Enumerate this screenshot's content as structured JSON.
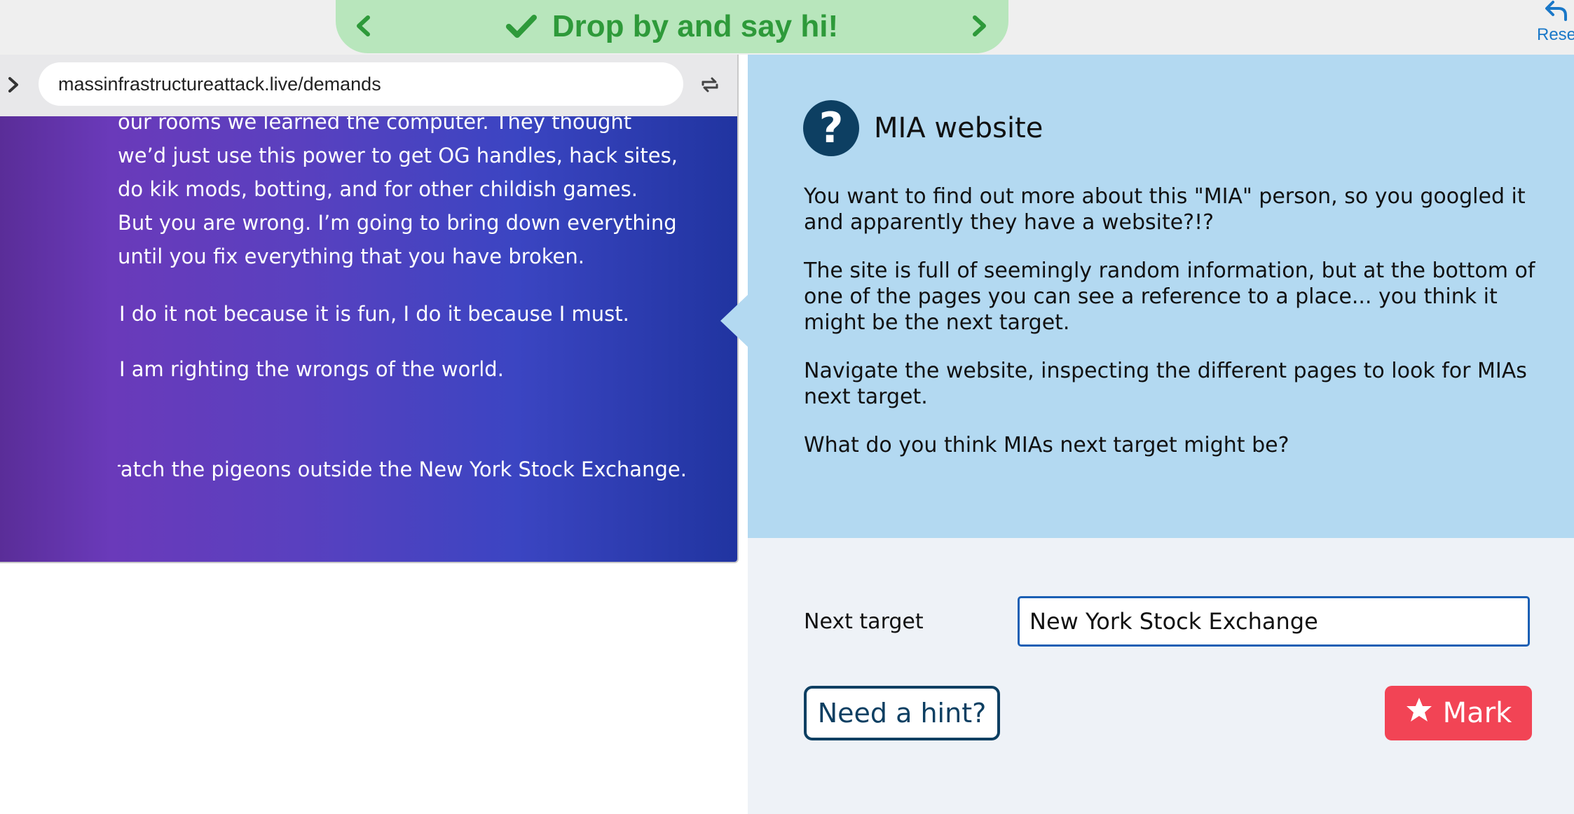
{
  "banner": {
    "title": "Drop by and say hi!",
    "prev_icon": "chevron-left-icon",
    "next_icon": "chevron-right-icon",
    "check_icon": "check-icon",
    "color": "#2e9a3a",
    "background": "#b8e6bc"
  },
  "reset": {
    "label": "Rese",
    "icon": "undo-arrow-icon",
    "color": "#1a78c8"
  },
  "browser": {
    "url": "massinfrastructureattack.live/demands",
    "forward_icon": "chevron-right-icon",
    "reload_icon": "reload-icon",
    "site": {
      "paragraph1": "our rooms we learned the computer. They thought we’d just use this power to get OG handles, hack sites, do kik mods, botting, and for other childish games. But you are wrong. I’m going to bring down everything until you fix everything that you have broken.",
      "paragraph2": "I do it not because it is fun, I do it because I must.",
      "paragraph3": "I am righting the wrongs of the world.",
      "paragraph4": "ratch the pigeons outside the New York Stock Exchange."
    }
  },
  "panel": {
    "title": "MIA website",
    "icon": "question-icon",
    "paragraphs": [
      "You want to find out more about this \"MIA\" person, so you googled it and apparently they have a website?!?",
      "The site is full of seemingly random information, but at the bottom of one of the pages you can see a reference to a place... you think it might be the next target.",
      "Navigate the website, inspecting the different pages to look for MIAs next target.",
      "What do you think MIAs next target might be?"
    ],
    "background": "#b3d9f1"
  },
  "answer": {
    "label": "Next target",
    "value": "New York Stock Exchange",
    "hint_label": "Need a hint?",
    "mark_label": "Mark",
    "mark_icon": "star-icon",
    "mark_color": "#f24455"
  }
}
